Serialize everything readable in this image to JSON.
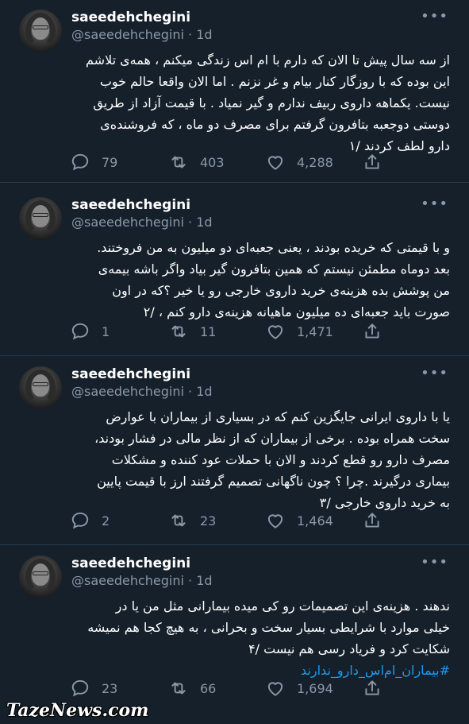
{
  "tweets": [
    {
      "name": "saeedehchegini",
      "handle": "@saeedehchegini",
      "sep": "·",
      "time": "1d",
      "more": "•••",
      "lines": [
        "از سه سال پیش تا الان که دارم با ام اس زندگی میکنم ، همه‌ی تلاشم",
        "این بوده که با روزگار کنار بیام و غر نزنم . اما الان واقعا حالم خوب",
        "نیست. یکماهه داروی ربیف ندارم و گیر نمیاد . با قیمت آزاد از طریق",
        "دوستی دوجعبه بتافرون گرفتم برای مصرف دو ماه ، که فروشنده‌ی",
        "دارو لطف کردند /۱"
      ],
      "hashtag": "",
      "replies": "79",
      "retweets": "403",
      "likes": "4,288"
    },
    {
      "name": "saeedehchegini",
      "handle": "@saeedehchegini",
      "sep": "·",
      "time": "1d",
      "more": "•••",
      "lines": [
        "و با قیمتی که خریده بودند ، یعنی جعبه‌ای دو میلیون به من فروختند.",
        "بعد دوماه مطمئن نیستم که همین بتافرون گیر بیاد واگر باشه بیمه‌ی",
        "من پوشش بده هزینه‌ی خرید داروی خارجی رو یا خیر ؟که در اون",
        "صورت باید جعبه‌ای ده میلیون ماهیانه هزینه‌ی دارو کنم ، /۲"
      ],
      "hashtag": "",
      "replies": "1",
      "retweets": "11",
      "likes": "1,471"
    },
    {
      "name": "saeedehchegini",
      "handle": "@saeedehchegini",
      "sep": "·",
      "time": "1d",
      "more": "•••",
      "lines": [
        "یا با داروی ایرانی جایگزین کنم که در بسیاری از بیماران با عوارض",
        "سخت همراه بوده . برخی از بیماران که از نظر مالی در فشار بودند،",
        "مصرف دارو رو قطع کردند و الان با حملات عود کننده و مشکلات",
        "بیماری درگیرند .چرا ؟ چون ناگهانی تصمیم گرفتند ارز با قیمت پایین",
        "به خرید داروی خارجی /۳"
      ],
      "hashtag": "",
      "replies": "2",
      "retweets": "23",
      "likes": "1,464"
    },
    {
      "name": "saeedehchegini",
      "handle": "@saeedehchegini",
      "sep": "·",
      "time": "1d",
      "more": "•••",
      "lines": [
        "ندهند . هزینه‌ی این تصمیمات رو کی میده بیمارانی مثل من یا در",
        "خیلی موارد با شرایطی بسیار سخت و بحرانی ، به هیچ کجا هم نمیشه",
        "شکایت کرد و فریاد رسی هم نیست /۴"
      ],
      "hashtag": "#بیماران_ام‌اس_دارو_ندارند",
      "replies": "23",
      "retweets": "66",
      "likes": "1,694"
    }
  ],
  "watermark": "TazeNews.com"
}
